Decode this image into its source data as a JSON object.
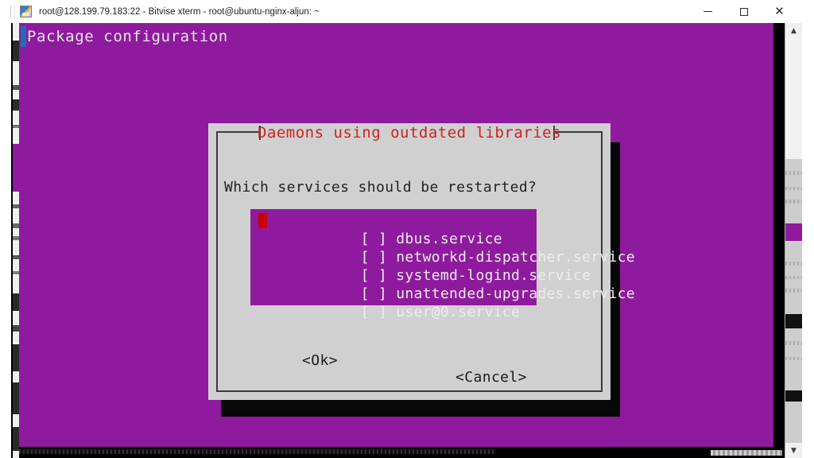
{
  "window": {
    "title": "root@128.199.79.183:22 - Bitvise xterm - root@ubuntu-nginx-aljun: ~",
    "app_icon": "bitvise-xterm-icon",
    "controls": {
      "minimize": "─",
      "maximize": "□",
      "close": "✕"
    }
  },
  "terminal": {
    "header_line": "Package configuration",
    "background_color": "#8e1a9d",
    "foreground_color": "#e6e6e6"
  },
  "scrollbar": {
    "up_arrow": "▲",
    "down_arrow": "▼"
  },
  "dialog": {
    "title": "Daemons using outdated libraries",
    "title_color": "#cc2222",
    "question": "Which services should be restarted?",
    "cursor_color": "#cc0000",
    "services": [
      {
        "checkbox": "[ ]",
        "label": "dbus.service",
        "checked": false,
        "cursor": true
      },
      {
        "checkbox": "[ ]",
        "label": "networkd-dispatcher.service",
        "checked": false,
        "cursor": false
      },
      {
        "checkbox": "[ ]",
        "label": "systemd-logind.service",
        "checked": false,
        "cursor": false
      },
      {
        "checkbox": "[ ]",
        "label": "unattended-upgrades.service",
        "checked": false,
        "cursor": false
      },
      {
        "checkbox": "[ ]",
        "label": "user@0.service",
        "checked": false,
        "cursor": false
      }
    ],
    "buttons": {
      "ok": "<Ok>",
      "cancel": "<Cancel>"
    }
  }
}
